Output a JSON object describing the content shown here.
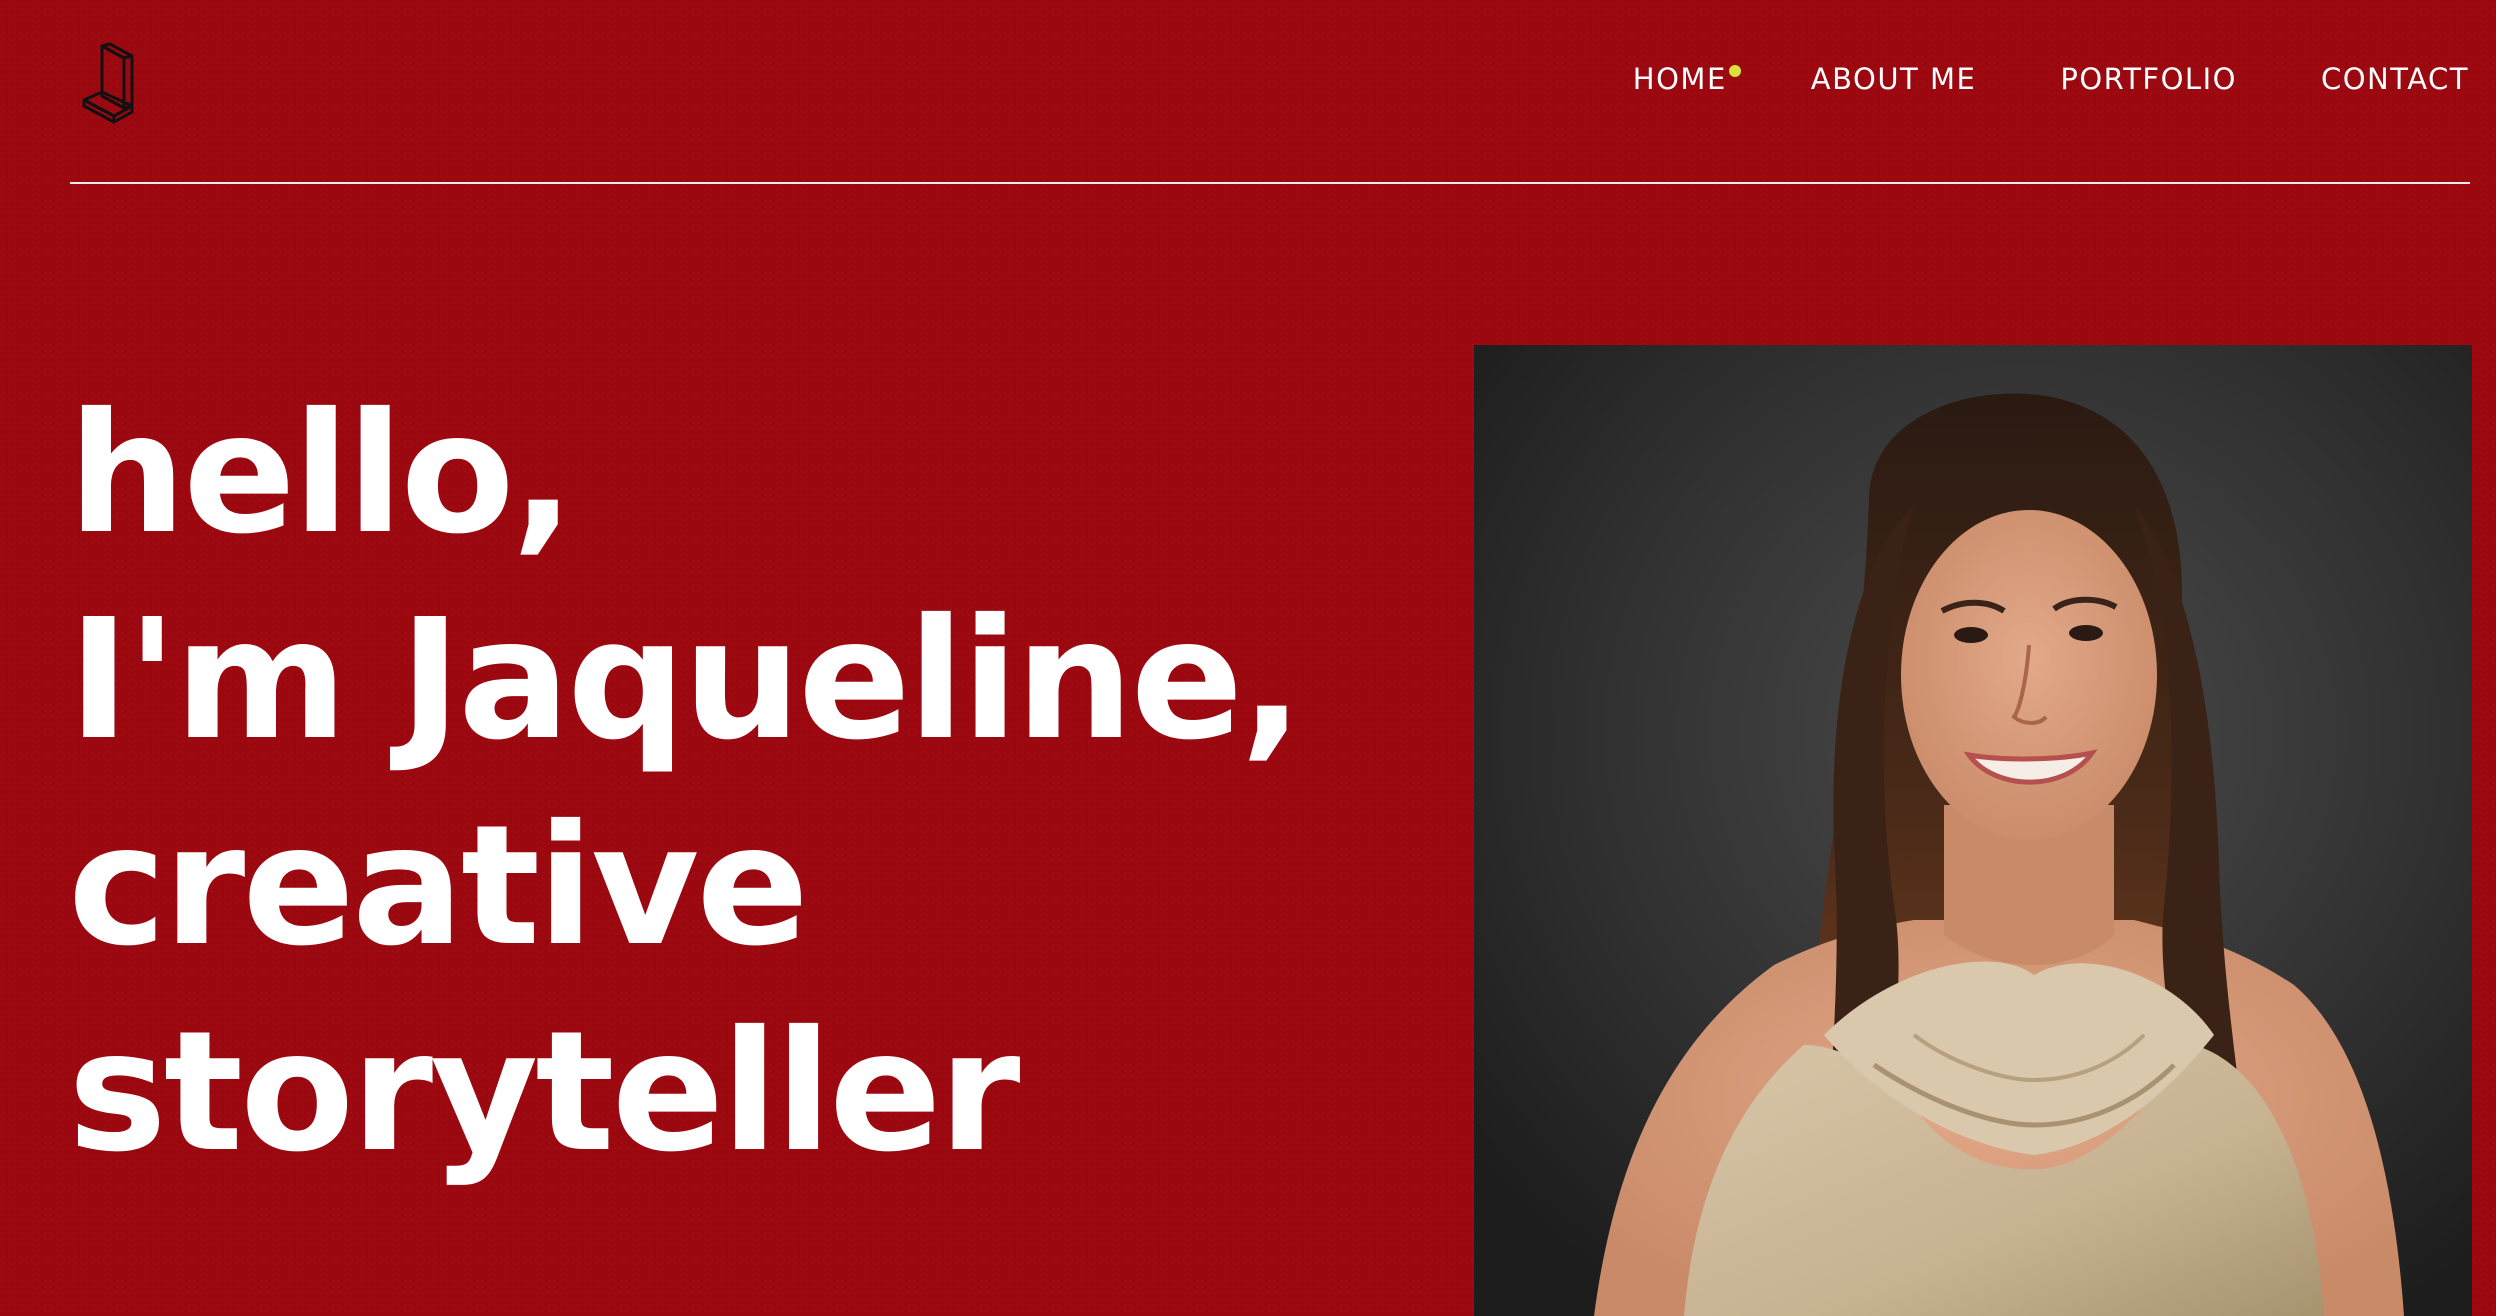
{
  "header": {
    "logo_icon": "isometric-letter-l-icon",
    "nav": {
      "items": [
        {
          "label": "HOME",
          "active": true
        },
        {
          "label": "ABOUT ME",
          "active": false
        },
        {
          "label": "PORTFOLIO",
          "active": false
        },
        {
          "label": "CONTACT",
          "active": false
        }
      ],
      "active_indicator_color": "#d9e23a"
    }
  },
  "hero": {
    "lines": [
      "hello,",
      "I'm Jaqueline,",
      "creative",
      "storyteller"
    ]
  },
  "portrait": {
    "image": "portrait photo of a smiling woman with long brown hair in a beige cowl-neck top against a dark grey background"
  },
  "colors": {
    "background": "#9c0810",
    "text": "#ffffff",
    "accent": "#d9e23a",
    "photo_background": "#2e2e2e",
    "top_fabric": "#cdb99b"
  }
}
